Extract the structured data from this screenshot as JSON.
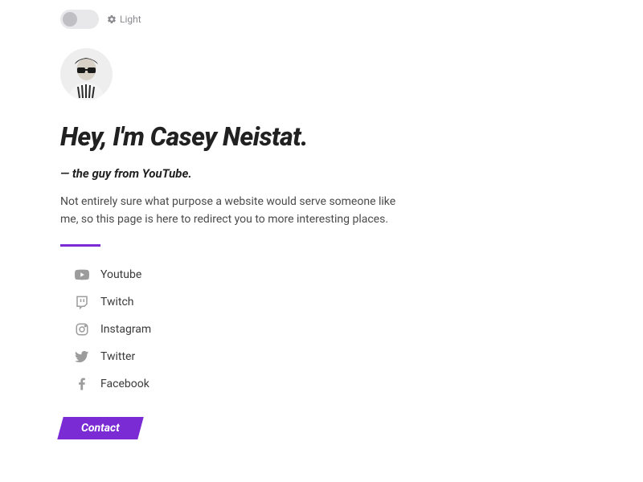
{
  "theme": {
    "label": "Light"
  },
  "heading": "Hey, I'm Casey Neistat.",
  "subheading": "— the guy from YouTube.",
  "intro": "Not entirely sure what purpose a website would serve someone like me, so this page is here to redirect you to more interesting places.",
  "accent_color": "#7a2bd4",
  "social": [
    {
      "icon": "youtube-icon",
      "label": "Youtube"
    },
    {
      "icon": "twitch-icon",
      "label": "Twitch"
    },
    {
      "icon": "instagram-icon",
      "label": "Instagram"
    },
    {
      "icon": "twitter-icon",
      "label": "Twitter"
    },
    {
      "icon": "facebook-icon",
      "label": "Facebook"
    }
  ],
  "contact_label": "Contact"
}
